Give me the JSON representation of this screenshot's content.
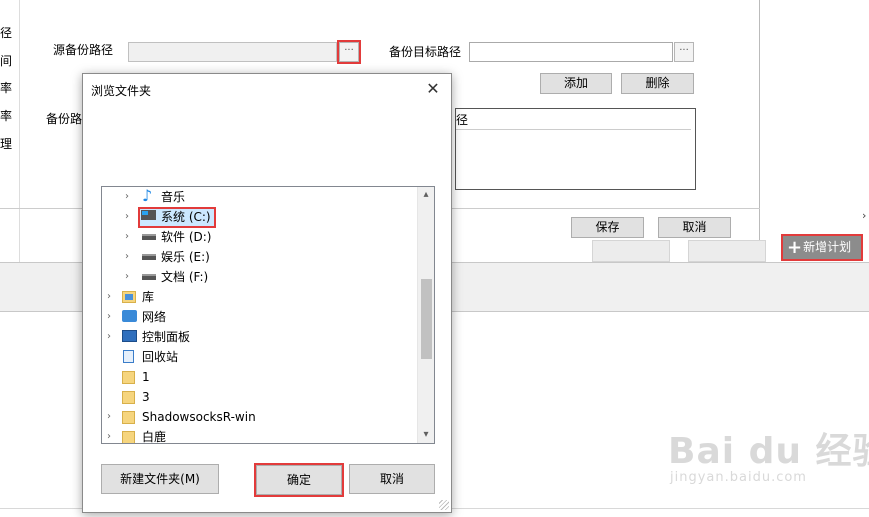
{
  "app": {
    "left_labels": [
      "径",
      "间",
      "率",
      "率",
      "理"
    ],
    "source_label": "源备份路径",
    "target_label": "备份目标路径",
    "backup_path_label": "备份路",
    "browse_label": "···",
    "add_label": "添加",
    "delete_label": "删除",
    "list_header": "径",
    "save_label": "保存",
    "cancel_label": "取消",
    "add_plan_label": "新增计划",
    "scroll_right": "›"
  },
  "dialog": {
    "title": "浏览文件夹",
    "close_glyph": "✕",
    "tree": [
      {
        "label": "音乐",
        "icon": "music-icon",
        "expandable": true,
        "level": 1
      },
      {
        "label": "系统 (C:)",
        "icon": "windows-drive-icon",
        "expandable": true,
        "level": 1,
        "selected": true
      },
      {
        "label": "软件 (D:)",
        "icon": "drive-icon",
        "expandable": true,
        "level": 1
      },
      {
        "label": "娱乐 (E:)",
        "icon": "drive-icon",
        "expandable": true,
        "level": 1
      },
      {
        "label": "文档 (F:)",
        "icon": "drive-icon",
        "expandable": true,
        "level": 1
      },
      {
        "label": "库",
        "icon": "library-icon",
        "expandable": true,
        "level": 0
      },
      {
        "label": "网络",
        "icon": "network-icon",
        "expandable": true,
        "level": 0
      },
      {
        "label": "控制面板",
        "icon": "control-panel-icon",
        "expandable": true,
        "level": 0
      },
      {
        "label": "回收站",
        "icon": "recycle-bin-icon",
        "expandable": false,
        "level": 0
      },
      {
        "label": "1",
        "icon": "folder-icon",
        "expandable": false,
        "level": 0
      },
      {
        "label": "3",
        "icon": "folder-icon",
        "expandable": false,
        "level": 0
      },
      {
        "label": "ShadowsocksR-win",
        "icon": "folder-icon",
        "expandable": true,
        "level": 0
      },
      {
        "label": "白鹿",
        "icon": "folder-icon",
        "expandable": true,
        "level": 0
      }
    ],
    "new_folder_label": "新建文件夹(M)",
    "ok_label": "确定",
    "cancel_label": "取消"
  },
  "watermark": {
    "main": "Bai du 经验",
    "sub": "jingyan.baidu.com"
  },
  "colors": {
    "highlight_red": "#e23b3b",
    "selection_blue": "#cce8ff",
    "add_plan_bg": "#8c8c8c"
  }
}
